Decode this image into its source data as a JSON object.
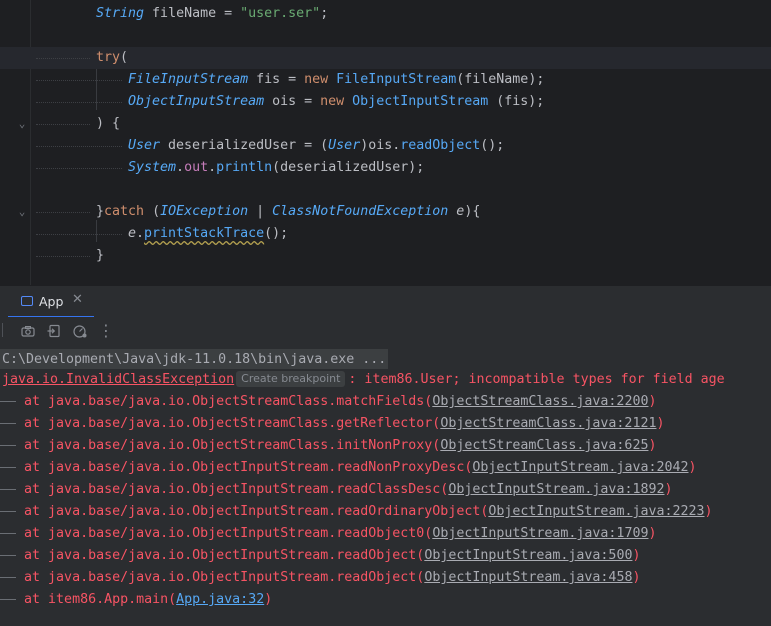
{
  "editor": {
    "lines": [
      {
        "tokens": [
          [
            "ty",
            "String"
          ],
          [
            "cls",
            " fileName "
          ],
          [
            "cls",
            "= "
          ],
          [
            "str",
            "\"user.ser\""
          ],
          [
            "cls",
            ";"
          ]
        ]
      },
      {
        "tokens": []
      },
      {
        "tokens": [
          [
            "kw",
            "try"
          ],
          [
            "cls",
            "("
          ]
        ]
      },
      {
        "tokens": [
          [
            "ty",
            "FileInputStream"
          ],
          [
            "cls",
            " fis "
          ],
          [
            "cls",
            "= "
          ],
          [
            "kw",
            "new "
          ],
          [
            "fn",
            "FileInputStream"
          ],
          [
            "cls",
            "(fileName);"
          ]
        ]
      },
      {
        "tokens": [
          [
            "ty",
            "ObjectInputStream"
          ],
          [
            "cls",
            " ois "
          ],
          [
            "cls",
            "= "
          ],
          [
            "kw",
            "new "
          ],
          [
            "fn",
            "ObjectInputStream"
          ],
          [
            "cls",
            " (fis);"
          ]
        ]
      },
      {
        "tokens": [
          [
            "cls",
            ") {"
          ]
        ]
      },
      {
        "tokens": [
          [
            "ty",
            "User"
          ],
          [
            "cls",
            " deserializedUser "
          ],
          [
            "cls",
            "= ("
          ],
          [
            "ty",
            "User"
          ],
          [
            "cls",
            ")ois."
          ],
          [
            "fn",
            "readObject"
          ],
          [
            "cls",
            "();"
          ]
        ]
      },
      {
        "tokens": [
          [
            "ty",
            "System"
          ],
          [
            "cls",
            "."
          ],
          [
            "fld",
            "out"
          ],
          [
            "cls",
            "."
          ],
          [
            "fn",
            "println"
          ],
          [
            "cls",
            "(deserializedUser);"
          ]
        ]
      },
      {
        "tokens": []
      },
      {
        "tokens": [
          [
            "cls",
            "}"
          ],
          [
            "kw",
            "catch "
          ],
          [
            "cls",
            "("
          ],
          [
            "ty",
            "IOException"
          ],
          [
            "cls",
            " | "
          ],
          [
            "ty",
            "ClassNotFoundException"
          ],
          [
            "param",
            " e"
          ],
          [
            "cls",
            "){"
          ]
        ]
      },
      {
        "tokens": [
          [
            "param",
            "e"
          ],
          [
            "cls",
            "."
          ],
          [
            "fn warn",
            "printStackTrace"
          ],
          [
            "cls",
            "();"
          ]
        ]
      },
      {
        "tokens": [
          [
            "cls",
            "}"
          ]
        ]
      }
    ]
  },
  "run_window": {
    "tab_label": "App",
    "close_glyph": "✕",
    "toolbar_icons": [
      "camera-icon",
      "import-icon",
      "profiler-icon",
      "more-icon"
    ],
    "more_glyph": "⋮"
  },
  "console": {
    "command": "C:\\Development\\Java\\jdk-11.0.18\\bin\\java.exe ...",
    "exception_class": "java.io.InvalidClassException",
    "breakpoint_chip": "Create breakpoint",
    "exception_message": ": item86.User; incompatible types for field age",
    "trace": [
      {
        "prefix": "at java.base/java.io.ObjectStreamClass.matchFields(",
        "link": "ObjectStreamClass.java:2200",
        "suffix": ")"
      },
      {
        "prefix": "at java.base/java.io.ObjectStreamClass.getReflector(",
        "link": "ObjectStreamClass.java:2121",
        "suffix": ")"
      },
      {
        "prefix": "at java.base/java.io.ObjectStreamClass.initNonProxy(",
        "link": "ObjectStreamClass.java:625",
        "suffix": ")"
      },
      {
        "prefix": "at java.base/java.io.ObjectInputStream.readNonProxyDesc(",
        "link": "ObjectInputStream.java:2042",
        "suffix": ")"
      },
      {
        "prefix": "at java.base/java.io.ObjectInputStream.readClassDesc(",
        "link": "ObjectInputStream.java:1892",
        "suffix": ")"
      },
      {
        "prefix": "at java.base/java.io.ObjectInputStream.readOrdinaryObject(",
        "link": "ObjectInputStream.java:2223",
        "suffix": ")"
      },
      {
        "prefix": "at java.base/java.io.ObjectInputStream.readObject0(",
        "link": "ObjectInputStream.java:1709",
        "suffix": ")"
      },
      {
        "prefix": "at java.base/java.io.ObjectInputStream.readObject(",
        "link": "ObjectInputStream.java:500",
        "suffix": ")"
      },
      {
        "prefix": "at java.base/java.io.ObjectInputStream.readObject(",
        "link": "ObjectInputStream.java:458",
        "suffix": ")"
      },
      {
        "prefix": "at item86.App.main(",
        "link": "App.java:32",
        "suffix": ")",
        "project": true
      }
    ]
  },
  "colors": {
    "background": "#1e1f22",
    "panel": "#2b2d30",
    "error": "#f75464",
    "keyword": "#cf8e6d",
    "type": "#57aaf7",
    "string": "#6aab73",
    "accent": "#3574f0"
  }
}
